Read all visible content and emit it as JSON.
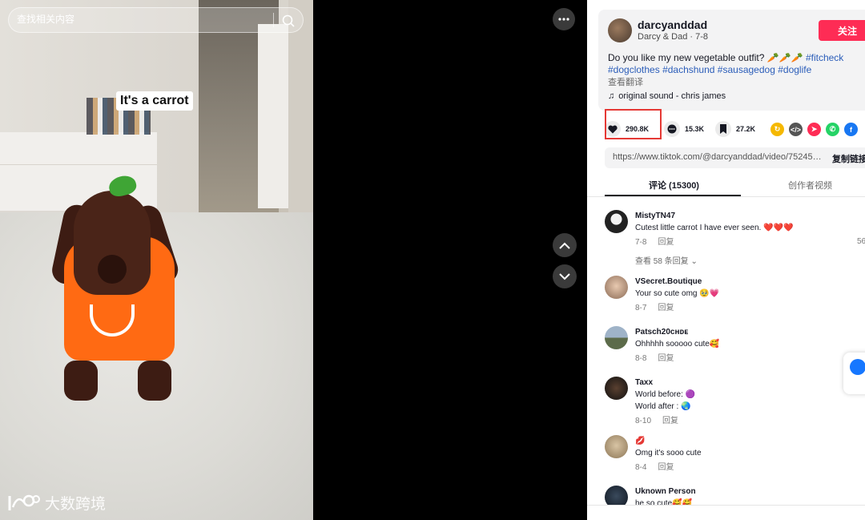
{
  "search": {
    "placeholder": "查找相关内容"
  },
  "video": {
    "caption": "It's a carrot",
    "watermark": "大数跨境"
  },
  "author": {
    "username": "darcyanddad",
    "subtitle": "Darcy & Dad · 7-8",
    "follow_label": "关注"
  },
  "description": {
    "text": "Do you like my new vegetable outfit? 🥕🥕🥕 ",
    "tags": [
      "#fitcheck",
      "#dogclothes",
      "#dachshund",
      "#sausagedog",
      "#doglife"
    ],
    "translate_label": "查看翻译"
  },
  "music": {
    "label": "original sound - chris james"
  },
  "actions": {
    "likes": "290.8K",
    "comments": "15.3K",
    "saves": "27.2K"
  },
  "share_icons": [
    {
      "name": "repost-icon",
      "color": "#f5b800",
      "glyph": "↻"
    },
    {
      "name": "embed-icon",
      "color": "#555555",
      "glyph": "</>"
    },
    {
      "name": "send-icon",
      "color": "#fe2c55",
      "glyph": "➤"
    },
    {
      "name": "whatsapp-icon",
      "color": "#25d366",
      "glyph": "✆"
    },
    {
      "name": "facebook-icon",
      "color": "#1877f2",
      "glyph": "f"
    }
  ],
  "link": {
    "url": "https://www.tiktok.com/@darcyanddad/video/7524532...",
    "copy_label": "复制链接"
  },
  "tabs": {
    "comments": "评论 (15300)",
    "creator_videos": "创作者视频"
  },
  "comments": [
    {
      "name": "MistyTN47",
      "text": "Cutest little carrot I have ever seen. ❤️❤️❤️",
      "date": "7-8",
      "reply": "回复",
      "more": "查看 58 条回复 ⌄",
      "side": "56"
    },
    {
      "name": "VSecret.Boutique",
      "text": "Your so cute omg 🥹💗",
      "date": "8-7",
      "reply": "回复"
    },
    {
      "name": "Patsch20ᴄʜᴅᴇ",
      "text": "Ohhhhh sooooo cute🥰",
      "date": "8-8",
      "reply": "回复"
    },
    {
      "name": "Taxx",
      "text": "World before: 🟣",
      "text2": "World after : 🌏",
      "date": "8-10",
      "reply": "回复"
    },
    {
      "name": "💋",
      "text": "Omg it's sooo cute",
      "date": "8-4",
      "reply": "回复"
    },
    {
      "name": "Uknown Person",
      "text": "he so cute🥰🥰"
    }
  ]
}
